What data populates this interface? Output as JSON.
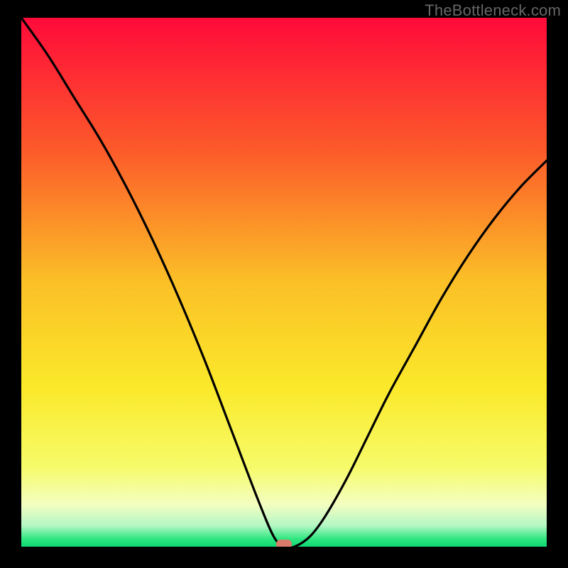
{
  "watermark": "TheBottleneck.com",
  "chart_data": {
    "type": "line",
    "title": "",
    "xlabel": "",
    "ylabel": "",
    "xlim": [
      0,
      100
    ],
    "ylim": [
      0,
      100
    ],
    "grid": false,
    "legend": false,
    "series": [
      {
        "name": "bottleneck-curve",
        "x": [
          0,
          5,
          10,
          15,
          20,
          25,
          30,
          35,
          40,
          45,
          48,
          50,
          52,
          55,
          58,
          62,
          66,
          70,
          75,
          80,
          85,
          90,
          95,
          100
        ],
        "values": [
          100,
          93,
          85,
          77,
          68,
          58,
          47,
          35,
          22,
          9,
          2,
          0,
          0,
          2,
          6,
          13,
          21,
          29,
          38,
          47,
          55,
          62,
          68,
          73
        ]
      }
    ],
    "marker": {
      "x": 50,
      "y": 0,
      "color": "#d97a6c"
    },
    "background_gradient": {
      "stops": [
        {
          "offset": 0.0,
          "color": "#ff0a3a"
        },
        {
          "offset": 0.25,
          "color": "#fc5a2a"
        },
        {
          "offset": 0.5,
          "color": "#fbc027"
        },
        {
          "offset": 0.7,
          "color": "#fbe92a"
        },
        {
          "offset": 0.85,
          "color": "#f6fb6a"
        },
        {
          "offset": 0.92,
          "color": "#f4fec1"
        },
        {
          "offset": 0.96,
          "color": "#b4f7c5"
        },
        {
          "offset": 0.985,
          "color": "#30e780"
        },
        {
          "offset": 1.0,
          "color": "#0fd873"
        }
      ]
    }
  }
}
